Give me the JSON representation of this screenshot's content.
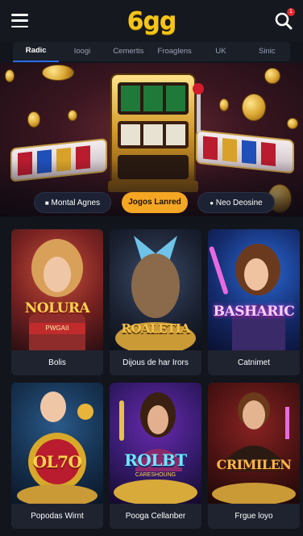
{
  "header": {
    "logo": "6gg",
    "notification_count": "1"
  },
  "tabs": [
    {
      "label": "Radic",
      "active": true
    },
    {
      "label": "Ioogi",
      "active": false
    },
    {
      "label": "Cemertis",
      "active": false
    },
    {
      "label": "Froaglens",
      "active": false
    },
    {
      "label": "UK",
      "active": false
    },
    {
      "label": "Sinic",
      "active": false
    }
  ],
  "banner": {
    "pills": [
      {
        "label": "Montal Agnes",
        "icon": "bullet-icon"
      },
      {
        "label": "Jogos Lanred",
        "icon": ""
      },
      {
        "label": "Neo Deosine",
        "icon": "bullet-icon"
      }
    ]
  },
  "games": [
    {
      "title": "NOLURA",
      "subtitle": "PWGAII",
      "caption": "Bolis"
    },
    {
      "title": "ROALETIA",
      "subtitle": "",
      "caption": "Dijous de har Irors"
    },
    {
      "title": "BASHARIC",
      "subtitle": "",
      "caption": "Catnimet"
    },
    {
      "title": "OL7O",
      "subtitle": "",
      "caption": "Popodas Wirnt"
    },
    {
      "title": "ROLBT",
      "subtitle": "CARESHOUNG",
      "caption": "Pooga Cellanber"
    },
    {
      "title": "CRIMILEN",
      "subtitle": "",
      "caption": "Frgue loyo"
    }
  ],
  "colors": {
    "background": "#12151c",
    "logo": "#f5c518",
    "accent_gold": "#f5a623",
    "tab_active": "#2a6df0",
    "notification": "#e0292f"
  }
}
